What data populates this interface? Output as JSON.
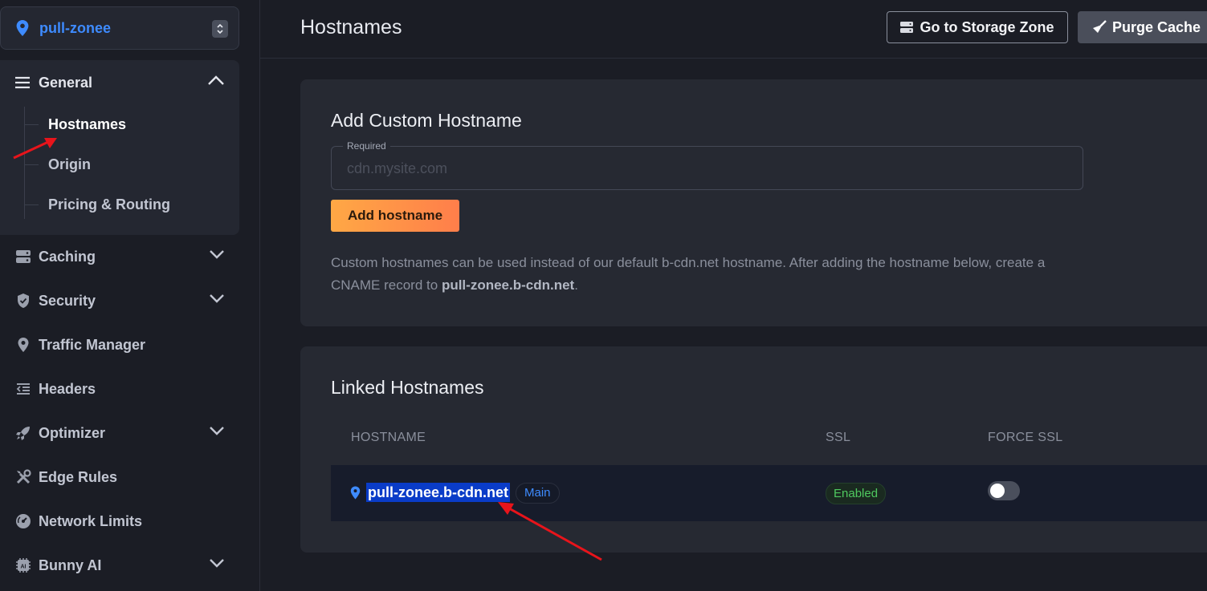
{
  "sidebar": {
    "zone_name": "pull-zonee",
    "general_label": "General",
    "sub_items": [
      "Hostnames",
      "Origin",
      "Pricing & Routing"
    ],
    "items": [
      {
        "label": "Caching",
        "icon": "server-icon"
      },
      {
        "label": "Security",
        "icon": "shield-icon"
      },
      {
        "label": "Traffic Manager",
        "icon": "location-pin-icon"
      },
      {
        "label": "Headers",
        "icon": "indent-lines-icon"
      },
      {
        "label": "Optimizer",
        "icon": "rocket-icon"
      },
      {
        "label": "Edge Rules",
        "icon": "tools-icon"
      },
      {
        "label": "Network Limits",
        "icon": "gauge-icon"
      },
      {
        "label": "Bunny AI",
        "icon": "ai-chip-icon"
      }
    ]
  },
  "header": {
    "title": "Hostnames",
    "storage_button": "Go to Storage Zone",
    "purge_button": "Purge Cache"
  },
  "add_card": {
    "title": "Add Custom Hostname",
    "field_legend": "Required",
    "field_placeholder": "cdn.mysite.com",
    "field_value": "",
    "add_button": "Add hostname",
    "help_prefix": "Custom hostnames can be used instead of our default b-cdn.net hostname. After adding the hostname below, create a CNAME record to ",
    "help_host": "pull-zonee.b-cdn.net",
    "help_suffix": "."
  },
  "linked_card": {
    "title": "Linked Hostnames",
    "columns": [
      "HOSTNAME",
      "SSL",
      "FORCE SSL"
    ],
    "rows": [
      {
        "hostname": "pull-zonee.b-cdn.net",
        "badge": "Main",
        "ssl": "Enabled",
        "force_ssl": false
      }
    ]
  },
  "colors": {
    "accent_blue": "#3e8bff",
    "add_button_gradient_start": "#ffa845",
    "add_button_gradient_end": "#ff7e4a",
    "ssl_enabled": "#4fc95f",
    "annotation_arrow": "#e8141b",
    "selection": "#0a3cc8"
  }
}
